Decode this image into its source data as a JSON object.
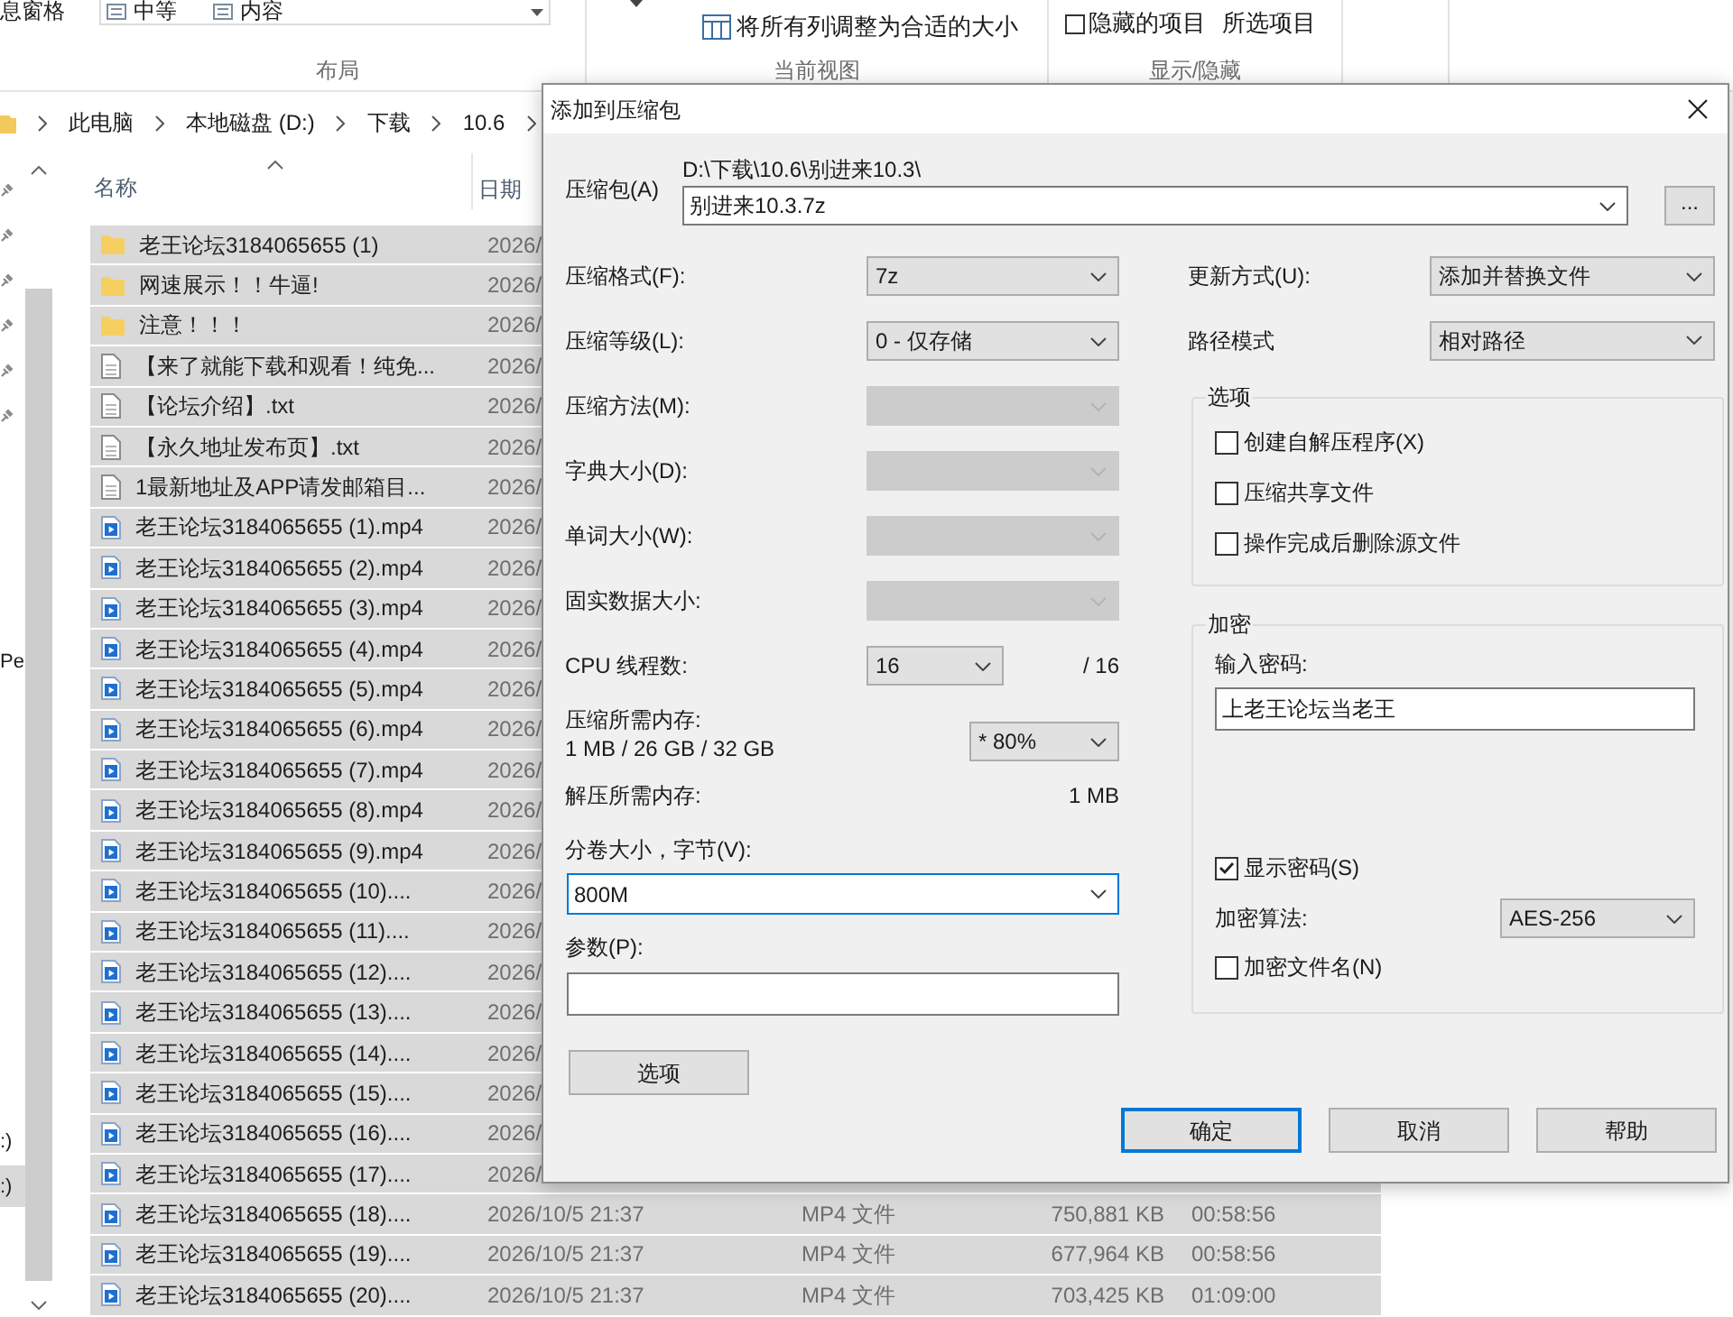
{
  "ribbon": {
    "pane_label": "息窗格",
    "layout_items": [
      "中等",
      "内容"
    ],
    "fit_columns": "将所有列调整为合适的大小",
    "hidden_items": {
      "label": "隐藏的项目",
      "checked": false
    },
    "hide_selected": "所选项目",
    "groups": [
      "布局",
      "当前视图",
      "显示/隐藏"
    ]
  },
  "address_bar": {
    "crumbs": [
      "此电脑",
      "本地磁盘 (D:)",
      "下载",
      "10.6"
    ]
  },
  "nav_pane": {
    "items": [
      {
        "label": "Pe",
        "selected": false
      },
      {
        "label": ":)",
        "selected": false
      },
      {
        "label": ":)",
        "selected": true
      }
    ]
  },
  "file_list": {
    "columns": [
      "名称",
      "日期"
    ],
    "rows": [
      {
        "kind": "folder",
        "name": "老王论坛3184065655 (1)",
        "date": "2026/",
        "selected": true
      },
      {
        "kind": "folder",
        "name": "网速展示！！牛逼!",
        "date": "2026/",
        "selected": true
      },
      {
        "kind": "folder",
        "name": "注意！！！",
        "date": "2026/",
        "selected": true
      },
      {
        "kind": "text",
        "name": "【来了就能下载和观看！纯免...",
        "date": "2026/",
        "selected": true
      },
      {
        "kind": "text",
        "name": "【论坛介绍】.txt",
        "date": "2026/",
        "selected": true
      },
      {
        "kind": "text",
        "name": "【永久地址发布页】.txt",
        "date": "2026/",
        "selected": true
      },
      {
        "kind": "text",
        "name": "1最新地址及APP请发邮箱目...",
        "date": "2026/",
        "selected": true
      },
      {
        "kind": "video",
        "name": "老王论坛3184065655 (1).mp4",
        "date": "2026/",
        "selected": true
      },
      {
        "kind": "video",
        "name": "老王论坛3184065655 (2).mp4",
        "date": "2026/",
        "selected": true
      },
      {
        "kind": "video",
        "name": "老王论坛3184065655 (3).mp4",
        "date": "2026/",
        "selected": true
      },
      {
        "kind": "video",
        "name": "老王论坛3184065655 (4).mp4",
        "date": "2026/",
        "selected": true
      },
      {
        "kind": "video",
        "name": "老王论坛3184065655 (5).mp4",
        "date": "2026/",
        "selected": true
      },
      {
        "kind": "video",
        "name": "老王论坛3184065655 (6).mp4",
        "date": "2026/",
        "selected": true
      },
      {
        "kind": "video",
        "name": "老王论坛3184065655 (7).mp4",
        "date": "2026/",
        "selected": true
      },
      {
        "kind": "video",
        "name": "老王论坛3184065655 (8).mp4",
        "date": "2026/",
        "selected": true
      },
      {
        "kind": "video",
        "name": "老王论坛3184065655 (9).mp4",
        "date": "2026/",
        "selected": true
      },
      {
        "kind": "video",
        "name": "老王论坛3184065655 (10)....",
        "date": "2026/",
        "selected": true
      },
      {
        "kind": "video",
        "name": "老王论坛3184065655 (11)....",
        "date": "2026/",
        "selected": true
      },
      {
        "kind": "video",
        "name": "老王论坛3184065655 (12)....",
        "date": "2026/",
        "selected": true
      },
      {
        "kind": "video",
        "name": "老王论坛3184065655 (13)....",
        "date": "2026/",
        "selected": true
      },
      {
        "kind": "video",
        "name": "老王论坛3184065655 (14)....",
        "date": "2026/",
        "selected": true
      },
      {
        "kind": "video",
        "name": "老王论坛3184065655 (15)....",
        "date": "2026/",
        "selected": true
      },
      {
        "kind": "video",
        "name": "老王论坛3184065655 (16)....",
        "date": "2026/",
        "selected": true
      },
      {
        "kind": "video",
        "name": "老王论坛3184065655 (17)....",
        "date": "2026/",
        "selected": true
      },
      {
        "kind": "video",
        "name": "老王论坛3184065655 (18)....",
        "date": "2026/10/5 21:37",
        "type": "MP4 文件",
        "size": "750,881 KB",
        "duration": "00:58:56",
        "selected": true
      },
      {
        "kind": "video",
        "name": "老王论坛3184065655 (19)....",
        "date": "2026/10/5 21:37",
        "type": "MP4 文件",
        "size": "677,964 KB",
        "duration": "00:58:56",
        "selected": true
      },
      {
        "kind": "video",
        "name": "老王论坛3184065655 (20)....",
        "date": "2026/10/5 21:37",
        "type": "MP4 文件",
        "size": "703,425 KB",
        "duration": "01:09:00",
        "selected": true
      }
    ]
  },
  "dialog": {
    "title": "添加到压缩包",
    "archive": {
      "label": "压缩包(A)",
      "folder": "D:\\下载\\10.6\\别进来10.3\\",
      "name": "别进来10.3.7z",
      "browse": "..."
    },
    "settings": [
      {
        "kind": "select",
        "label": "压缩格式(F):",
        "value": "7z",
        "disabled": false
      },
      {
        "kind": "select",
        "label": "压缩等级(L):",
        "value": "0 - 仅存储",
        "disabled": false
      },
      {
        "kind": "select",
        "label": "压缩方法(M):",
        "disabled": true
      },
      {
        "kind": "select",
        "label": "字典大小(D):",
        "disabled": true
      },
      {
        "kind": "select",
        "label": "单词大小(W):",
        "disabled": true
      },
      {
        "kind": "select",
        "label": "固实数据大小:",
        "disabled": true
      },
      {
        "kind": "threads",
        "label": "CPU 线程数:",
        "value": "16",
        "total": "/ 16"
      },
      {
        "kind": "memory",
        "label": "压缩所需内存:",
        "detail": "1 MB / 26 GB / 32 GB",
        "value": "* 80%"
      },
      {
        "kind": "info",
        "label": "解压所需内存:",
        "value": "1 MB"
      }
    ],
    "split": {
      "label": "分卷大小，字节(V):",
      "value": "800M",
      "focused": true
    },
    "parameters": {
      "label": "参数(P):"
    },
    "options_button": "选项",
    "update_mode": {
      "label": "更新方式(U):",
      "value": "添加并替换文件"
    },
    "path_mode": {
      "label": "路径模式",
      "value": "相对路径"
    },
    "options": {
      "title": "选项",
      "checkboxes": [
        {
          "label": "创建自解压程序(X)",
          "checked": false
        },
        {
          "label": "压缩共享文件",
          "checked": false
        },
        {
          "label": "操作完成后删除源文件",
          "checked": false
        }
      ]
    },
    "encryption": {
      "title": "加密",
      "password_label": "输入密码:",
      "password": "上老王论坛当老王",
      "show_password": {
        "label": "显示密码(S)",
        "checked": true
      },
      "method_label": "加密算法:",
      "method": "AES-256",
      "encrypt_names": {
        "label": "加密文件名(N)",
        "checked": false
      }
    },
    "buttons": [
      {
        "label": "确定",
        "default": true
      },
      {
        "label": "取消",
        "default": false
      },
      {
        "label": "帮助",
        "default": false
      }
    ]
  }
}
